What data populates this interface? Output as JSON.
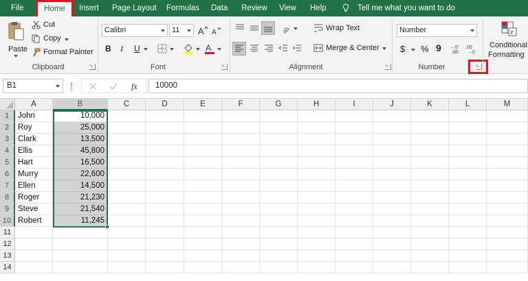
{
  "menu": {
    "tabs": [
      "File",
      "Home",
      "Insert",
      "Page Layout",
      "Formulas",
      "Data",
      "Review",
      "View",
      "Help"
    ],
    "tell_me": "Tell me what you want to do"
  },
  "ribbon": {
    "clipboard": {
      "paste": "Paste",
      "cut": "Cut",
      "copy": "Copy",
      "format_painter": "Format Painter",
      "label": "Clipboard"
    },
    "font": {
      "name": "Calibri",
      "size": "11",
      "bold": "B",
      "italic": "I",
      "underline": "U",
      "label": "Font"
    },
    "alignment": {
      "wrap_text": "Wrap Text",
      "merge_center": "Merge & Center",
      "label": "Alignment"
    },
    "number": {
      "format": "Number",
      "currency": "$",
      "percent": "%",
      "comma": "9",
      "label": "Number"
    },
    "styles": {
      "conditional": "Conditional",
      "formatting": "Formatting"
    }
  },
  "formula_bar": {
    "name_box": "B1",
    "fx": "fx",
    "value": "10000"
  },
  "grid": {
    "columns": [
      "A",
      "B",
      "C",
      "D",
      "E",
      "F",
      "G",
      "H",
      "I",
      "J",
      "K",
      "L",
      "M"
    ],
    "rows": [
      "1",
      "2",
      "3",
      "4",
      "5",
      "6",
      "7",
      "8",
      "9",
      "10",
      "11",
      "12",
      "13",
      "14"
    ],
    "names": [
      "John",
      "Roy",
      "Clark",
      "Ellis",
      "Hart",
      "Murry",
      "Ellen",
      "Roger",
      "Steve",
      "Robert"
    ],
    "values": [
      "10,000",
      "25,000",
      "13,500",
      "45,800",
      "16,500",
      "22,600",
      "14,500",
      "21,230",
      "21,540",
      "11,245"
    ]
  },
  "colors": {
    "excel_green": "#217346",
    "highlight_red": "#e0151c",
    "selection_gray": "#d3d3d3"
  },
  "icons": [
    "lightbulb-icon",
    "paste-icon",
    "scissors-icon",
    "copy-icon",
    "paintbrush-icon",
    "bold-icon",
    "italic-icon",
    "underline-icon",
    "borders-icon",
    "fill-color-icon",
    "font-color-icon",
    "increase-font-icon",
    "decrease-font-icon",
    "align-top-icon",
    "align-middle-icon",
    "align-bottom-icon",
    "orientation-icon",
    "wrap-text-icon",
    "align-left-icon",
    "align-center-icon",
    "align-right-icon",
    "decrease-indent-icon",
    "increase-indent-icon",
    "merge-center-icon",
    "increase-decimal-icon",
    "decrease-decimal-icon",
    "conditional-formatting-icon",
    "cancel-icon",
    "enter-icon",
    "dialog-launcher-icon"
  ]
}
